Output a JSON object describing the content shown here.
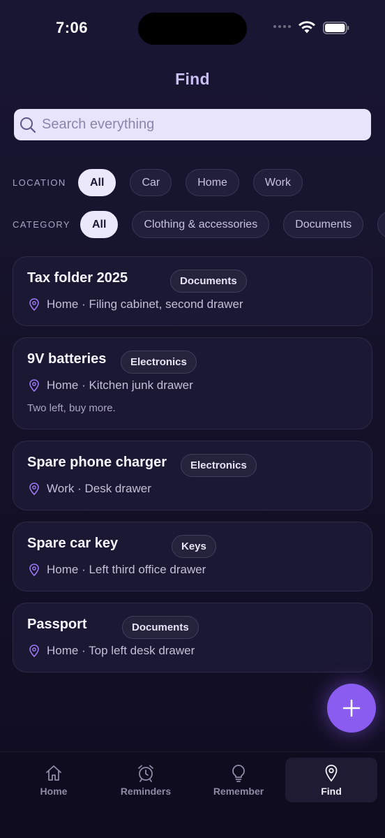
{
  "status": {
    "time": "7:06"
  },
  "header": {
    "title": "Find"
  },
  "search": {
    "placeholder": "Search everything",
    "value": ""
  },
  "filters": {
    "location": {
      "label": "LOCATION",
      "chips": [
        "All",
        "Car",
        "Home",
        "Work"
      ],
      "selected": "All"
    },
    "category": {
      "label": "CATEGORY",
      "chips": [
        "All",
        "Clothing & accessories",
        "Documents"
      ],
      "selected": "All"
    }
  },
  "items": [
    {
      "title": "Tax folder 2025",
      "category": "Documents",
      "location": "Home · Filing cabinet, second drawer",
      "note": ""
    },
    {
      "title": "9V batteries",
      "category": "Electronics",
      "location": "Home · Kitchen junk drawer",
      "note": "Two left, buy more."
    },
    {
      "title": "Spare phone charger",
      "category": "Electronics",
      "location": "Work · Desk drawer",
      "note": ""
    },
    {
      "title": "Spare car key",
      "category": "Keys",
      "location": "Home · Left third office drawer",
      "note": ""
    },
    {
      "title": "Passport",
      "category": "Documents",
      "location": "Home · Top left desk drawer",
      "note": ""
    }
  ],
  "fab": {
    "icon": "plus-icon"
  },
  "tabs": [
    {
      "label": "Home",
      "icon": "house-icon"
    },
    {
      "label": "Reminders",
      "icon": "alarm-clock-icon"
    },
    {
      "label": "Remember",
      "icon": "lightbulb-icon"
    },
    {
      "label": "Find",
      "icon": "map-pin-icon"
    }
  ],
  "active_tab": "Find",
  "colors": {
    "accent": "#8a5cf0",
    "background": "#141128",
    "chip_active": "#ebe8fb",
    "title": "#c9c0f4"
  }
}
